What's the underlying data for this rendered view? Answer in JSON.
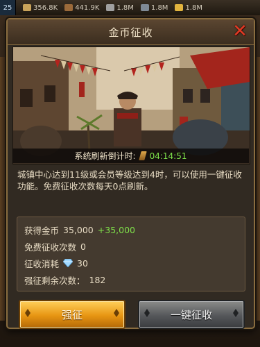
{
  "topbar": {
    "level": "25",
    "resources": [
      {
        "icon": "food-icon",
        "value": "356.8K",
        "color": "#c9a35a"
      },
      {
        "icon": "wood-icon",
        "value": "441.9K",
        "color": "#9b6a3a"
      },
      {
        "icon": "stone-icon",
        "value": "1.8M",
        "color": "#a0a0a0"
      },
      {
        "icon": "ore-icon",
        "value": "1.8M",
        "color": "#7f8a96"
      },
      {
        "icon": "gold-icon",
        "value": "1.8M",
        "color": "#e2b43e"
      }
    ]
  },
  "dialog": {
    "title": "金币征收",
    "timer_label": "系统刷新倒计时:",
    "timer_value": "04:14:51",
    "description": "城镇中心达到11级或会员等级达到4时，可以使用一键征收功能。免费征收次数每天0点刷新。",
    "info": {
      "gold_label": "获得金币",
      "gold_value": "35,000",
      "gold_bonus": "+35,000",
      "free_label": "免费征收次数",
      "free_value": "0",
      "cost_label": "征收消耗",
      "cost_value": "30",
      "remaining_label": "强征剩余次数：",
      "remaining_value": "182"
    },
    "buttons": {
      "force_collect": "强征",
      "one_click_collect": "一键征收"
    }
  },
  "colors": {
    "accent_gold": "#e79512",
    "bonus_green": "#7fe04a",
    "close_red": "#e23a24",
    "timer_green": "#7ee24a"
  }
}
